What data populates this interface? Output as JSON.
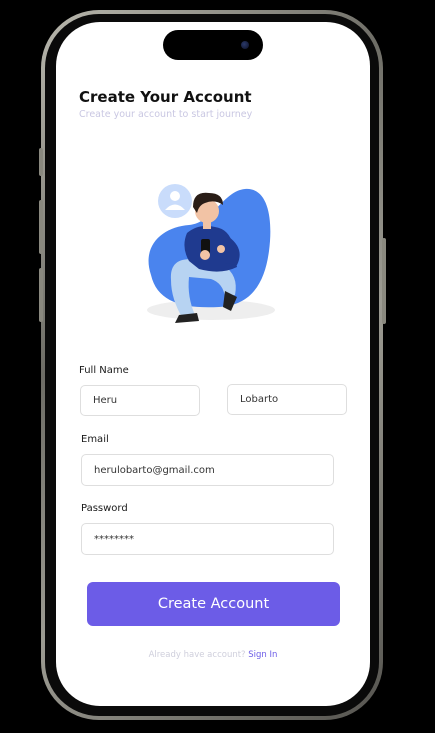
{
  "header": {
    "title": "Create Your Account",
    "subtitle": "Create your account to start journey"
  },
  "illustration": {
    "icon": "person-with-phone-illustration",
    "colors": {
      "blob": "#4a84ee",
      "shirt": "#1f3a8f",
      "pants": "#b7d3f2",
      "avatar_bubble": "#c9dcfb"
    }
  },
  "form": {
    "full_name_label": "Full Name",
    "first_name_value": "Heru",
    "last_name_value": "Lobarto",
    "email_label": "Email",
    "email_value": "herulobarto@gmail.com",
    "password_label": "Password",
    "password_value": "********"
  },
  "actions": {
    "create_account_label": "Create Account"
  },
  "footer": {
    "prompt": "Already have account?",
    "sign_in_label": "Sign In"
  },
  "colors": {
    "accent": "#6c5ce7",
    "subtitle": "#c9c7e2",
    "input_border": "#dedede"
  }
}
